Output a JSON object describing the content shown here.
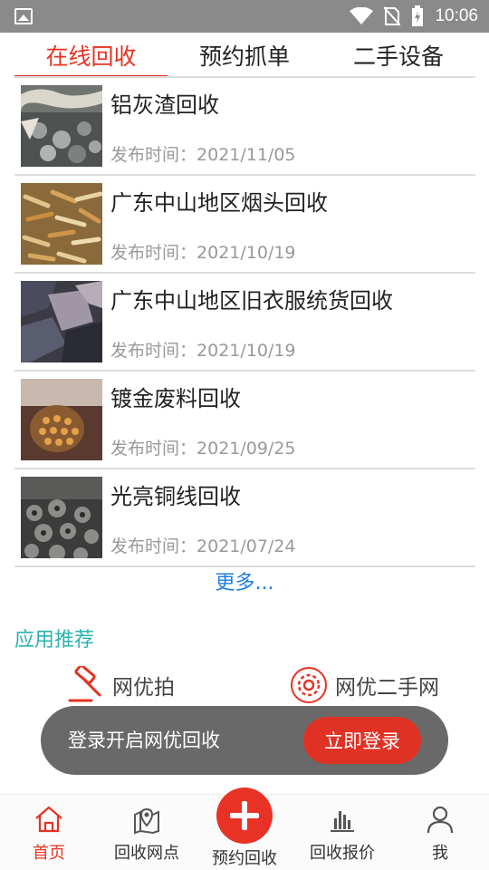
{
  "status_bar": {
    "time": "10:06"
  },
  "tabs": [
    {
      "label": "在线回收",
      "active": true
    },
    {
      "label": "预约抓单",
      "active": false
    },
    {
      "label": "二手设备",
      "active": false
    }
  ],
  "list": {
    "date_prefix": "发布时间：",
    "items": [
      {
        "title": "铝灰渣回收",
        "date": "2021/11/05"
      },
      {
        "title": "广东中山地区烟头回收",
        "date": "2021/10/19"
      },
      {
        "title": "广东中山地区旧衣服统货回收",
        "date": "2021/10/19"
      },
      {
        "title": "镀金废料回收",
        "date": "2021/09/25"
      },
      {
        "title": "光亮铜线回收",
        "date": "2021/07/24"
      }
    ],
    "more_label": "更多..."
  },
  "recommend": {
    "title": "应用推荐",
    "apps": [
      {
        "label": "网优拍",
        "icon": "gavel-icon"
      },
      {
        "label": "网优二手网",
        "icon": "gear-icon"
      }
    ]
  },
  "toast": {
    "message": "登录开启网优回收",
    "button": "立即登录"
  },
  "bottom_nav": [
    {
      "label": "首页",
      "icon": "home-icon",
      "active": true
    },
    {
      "label": "回收网点",
      "icon": "map-pin-icon",
      "active": false
    },
    {
      "label": "预约回收",
      "icon": "plus-icon",
      "active": false
    },
    {
      "label": "回收报价",
      "icon": "bar-chart-icon",
      "active": false
    },
    {
      "label": "我",
      "icon": "user-icon",
      "active": false
    }
  ],
  "colors": {
    "accent_red": "#e53323",
    "link_blue": "#1f7ee0",
    "teal": "#2cb3b0",
    "status_bar": "#8a8a8a"
  }
}
